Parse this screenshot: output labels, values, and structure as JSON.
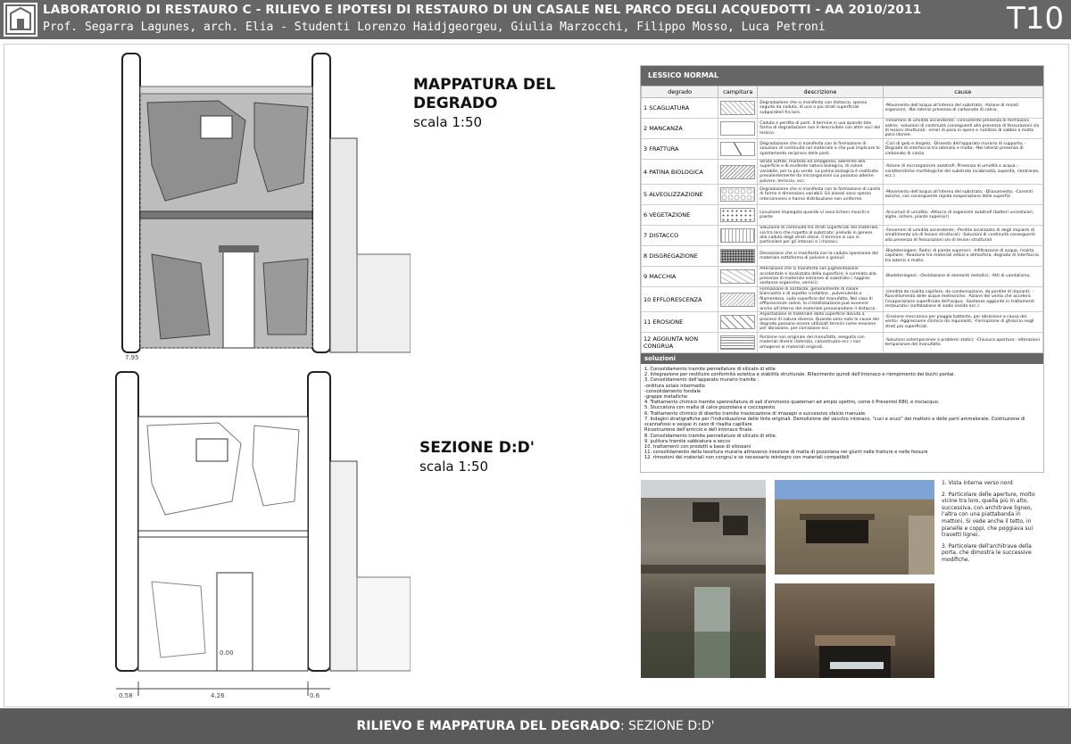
{
  "header": {
    "title": "LABORATORIO DI RESTAURO C - RILIEVO E IPOTESI DI RESTAURO DI UN CASALE NEL PARCO DEGLI ACQUEDOTTI - AA 2010/2011",
    "subtitle": "Prof. Segarra Lagunes, arch. Elia - Studenti Lorenzo Haidjgeorgeu, Giulia Marzocchi, Filippo Mosso, Luca Petroni",
    "code": "T10"
  },
  "mappatura": {
    "title": "MAPPATURA DEL DEGRADO",
    "scale": "scala 1:50"
  },
  "sezione": {
    "title": "SEZIONE D:D'",
    "scale": "scala 1:50"
  },
  "dimensions": {
    "top_level": "7.95",
    "base_level": "0.00",
    "d1": "0.58",
    "d2": "4.26",
    "d3": "0.6"
  },
  "lessico": {
    "title": "LESSICO NORMAL",
    "columns": [
      "degrado",
      "campitura",
      "descrizione",
      "cause"
    ],
    "rows": [
      {
        "name": "1 SCAGLIATURA",
        "desc": "Degradazione che si manifesta con distacco, spesso seguito da caduta, di uno o più strati superficiali subparalleli fra loro.",
        "cause": "-Movimento dell'acqua all'interno del substrato; -Azione di miceti organismi; -Nei laterizi presenza di carbonato di calcio."
      },
      {
        "name": "2 MANCANZA",
        "desc": "Caduta e perdita di parti. Il termine si usa quando tale forma di degradazione non è descrivibile con altre voci del lessico.",
        "cause": "-Fenomeni di umidità ascendente; -consistente presenza di formazioni saline; -soluzioni di continuità conseguenti alla presenza di fessurazioni s/o di lesioni strutturali; -errori di posa in opera e riutilizzo di sabbie a malta poco idonee."
      },
      {
        "name": "3 FRATTURA",
        "desc": "Degradazione che si manifesta con la formazione di soluzioni di continuità nel materiale e che può implicare lo spostamento reciproco delle parti.",
        "cause": "-Cicli di gelo e disgelo; -Dissesto dell'apparato murario di supporto; -Degrado di interfaccia tra laterizio e malta; -Nei laterizi presenza di carbonato di calcio."
      },
      {
        "name": "4 PATINA BIOLOGICA",
        "desc": "Strato sottile, morbido ed omogeneo, aderente alla superficie e di evidente natura biologica, di colore variabile, per lo più verde. La patina biologica è costituita prevalentemente da microrganismi cui possono aderire polvere, terriccio, ecc.",
        "cause": "-Azione di microrganismi autotrofi; Presenza di umidità e acqua; -caratteristiche morfologiche del substrato (scabrosità, asperità, rientranze, ecc.)"
      },
      {
        "name": "5 ALVEOLIZZAZIONE",
        "desc": "Degradazione che si manifesta con la formazione di cavità di forme e dimensioni variabili. Gli alveoli sono spesso interconnessi e hanno distribuzione non uniforme.",
        "cause": "-Movimento dell'acqua all'interno del substrato; -Dilavamento; -Correnti eoliche, con conseguente rapida evaporazione delle superfici"
      },
      {
        "name": "6 VEGETAZIONE",
        "desc": "Locuzione impiegata quando vi sono licheni muschi e piante",
        "cause": "-Accumuli di umidità; -Attacco di organismi autotrofi (batteri unicellulari, alghe, licheni, piante superiori)"
      },
      {
        "name": "7 DISTACCO",
        "desc": "Soluzione di continuità tra strati superficiali del materiale, sia tra loro che rispetto al substrato: prelude in genere alla caduta degli strati stessi. Il termine si usa in particolare per gli intonaci e i mosaici.",
        "cause": "-Fenomeni di umidità ascendente; -Perdita localizzata di degli impianti di smaltimento s/o di lesioni strutturali; -Soluzioni di continuità conseguenti alla presenza di fessurazioni s/o di lesioni strutturali"
      },
      {
        "name": "8 DISGREGAZIONE",
        "desc": "Decoesione che si manifesta con la caduta spontanea del materiale sottoforma di polvere o granuli",
        "cause": "-Biodeteriogeni; Radici di piante superiori; -Infiltrazione di acqua, risalita capillare; -Reazione tra materiali edilizi e atmosfera, degrado di interfaccia tra laterizi e malta."
      },
      {
        "name": "9 MACCHIA",
        "desc": "Alterazione che si manifesta con pigmentazione accidentale e localizzata della superficie; è correlata alla presenza di materiale estraneo al substrato ( ruggine, sostanze organiche, vernici)",
        "cause": "-Biodeteriogeni; -Ossidazione di elementi metallici; -Atti di vandalismo."
      },
      {
        "name": "10 EFFLORESCENZA",
        "desc": "Formazione di sostanze, generalmente di colore biancastro e di aspetto cristallino , pulverulento o filamentoso, sulla superficie del manufatto. Nel caso di efflorescenze saline, la cristallizzazione può avvenire anche all'interno del materiale provocandone il distacco.",
        "cause": "-Umidità da risalita capillare, da condensazione, da perdite di impianti; -Ruscellamento delle acque meteoriche; -Azione del vento che accelera l'evaporazione superficiale dell'acqua; -Sostanze aggiunte in trattamenti restaurativi (solfatazione di sodio ossido ecc.)"
      },
      {
        "name": "11 EROSIONE",
        "desc": "Asportazione di materiale dalla superficie dovuta a processi di natura diversa. Quando sono note le cause del degrado possono essere utilizzati termini come erosione per abrasione, per corrasione ecc.",
        "cause": "-Erosione meccanica per pioggia battente, per abrasione a causa del vento; -Aggressione chimica da inquinanti; -Formazione di ghiaccio negli strati più superficiali."
      },
      {
        "name": "12 AGGIUNTA NON CONGRUA",
        "desc": "Porzione non originale del manufatto, eseguita con materiali diversi (laterizio, calcestruzzo ecc.) non omogenei ai materiali originali.",
        "cause": "-Soluzioni estemporanee a problemi statici; -Chiusura aperture; -alterazioni temporanee del manufatto."
      }
    ],
    "solutions_title": "soluzioni",
    "solutions": [
      "1. Consolidamento tramite pennellature di silicato di etile",
      "2. Integrazione per restituire conformità estetica e stabilità strutturale. Rifacimento quindi dell'intonaco e riempimento dei buchi pontai.",
      "3. Consolidamento dell'apparato murario tramite :",
      "-orditura solaio intermedio",
      "-consolidamento fondale",
      "-grappe metalliche",
      "4. Trattamento chimico tramite spennellatura di sali d'ammonio quaternari ad ampio spettro, come il Preventol R80, e risciacquo.",
      "5. Stuccatura con malta di calce pozzolana e cocciopesto.",
      "6. Trattamento chimico di diserbo tramite traslocazione di imazapir e successivo sfalcio manuale.",
      "7. Indagini stratigrafiche per l'individuazione delle tinte originali. Demolizione del vecchio intonaco, \"cuci e scuci\" dei mattoni e delle parti ammalorate. Costituzione di scannafossi e vespai in caso di risalita capillare",
      "Ricostruzione dell'arriccio e dell intonaco finale.",
      "8. Consolidamento tramite pennellature di silicato di etile.",
      "9. pulitura tramite sabbiatura a secco",
      "10. trattamenti con prodotti a base di silossani",
      "11. consolidamento della tessitura muraria attraverso iniezione di malta di pozzolana nei giunti nelle fratture e nelle fessure",
      "12. rimozioni dei materiali non congrui e se necessario reintegro con materiali compatibili"
    ]
  },
  "notes": [
    "1. Vista interna verso nord",
    "2. Particolare delle aperture, molto vicine tra loro, quella più in alto, successiva, con architrave ligneo, l'altra con una piattabanda in mattoni. Si vede anche il tetto, in pianelle e coppi, che poggiava sui travetti lignei.",
    "3. Particolare dell'architrave della porta, che dimostra le successive modifiche."
  ],
  "footer": {
    "bold": "RILIEVO E MAPPATURA DEL DEGRADO",
    "rest": ": SEZIONE D:D'"
  }
}
